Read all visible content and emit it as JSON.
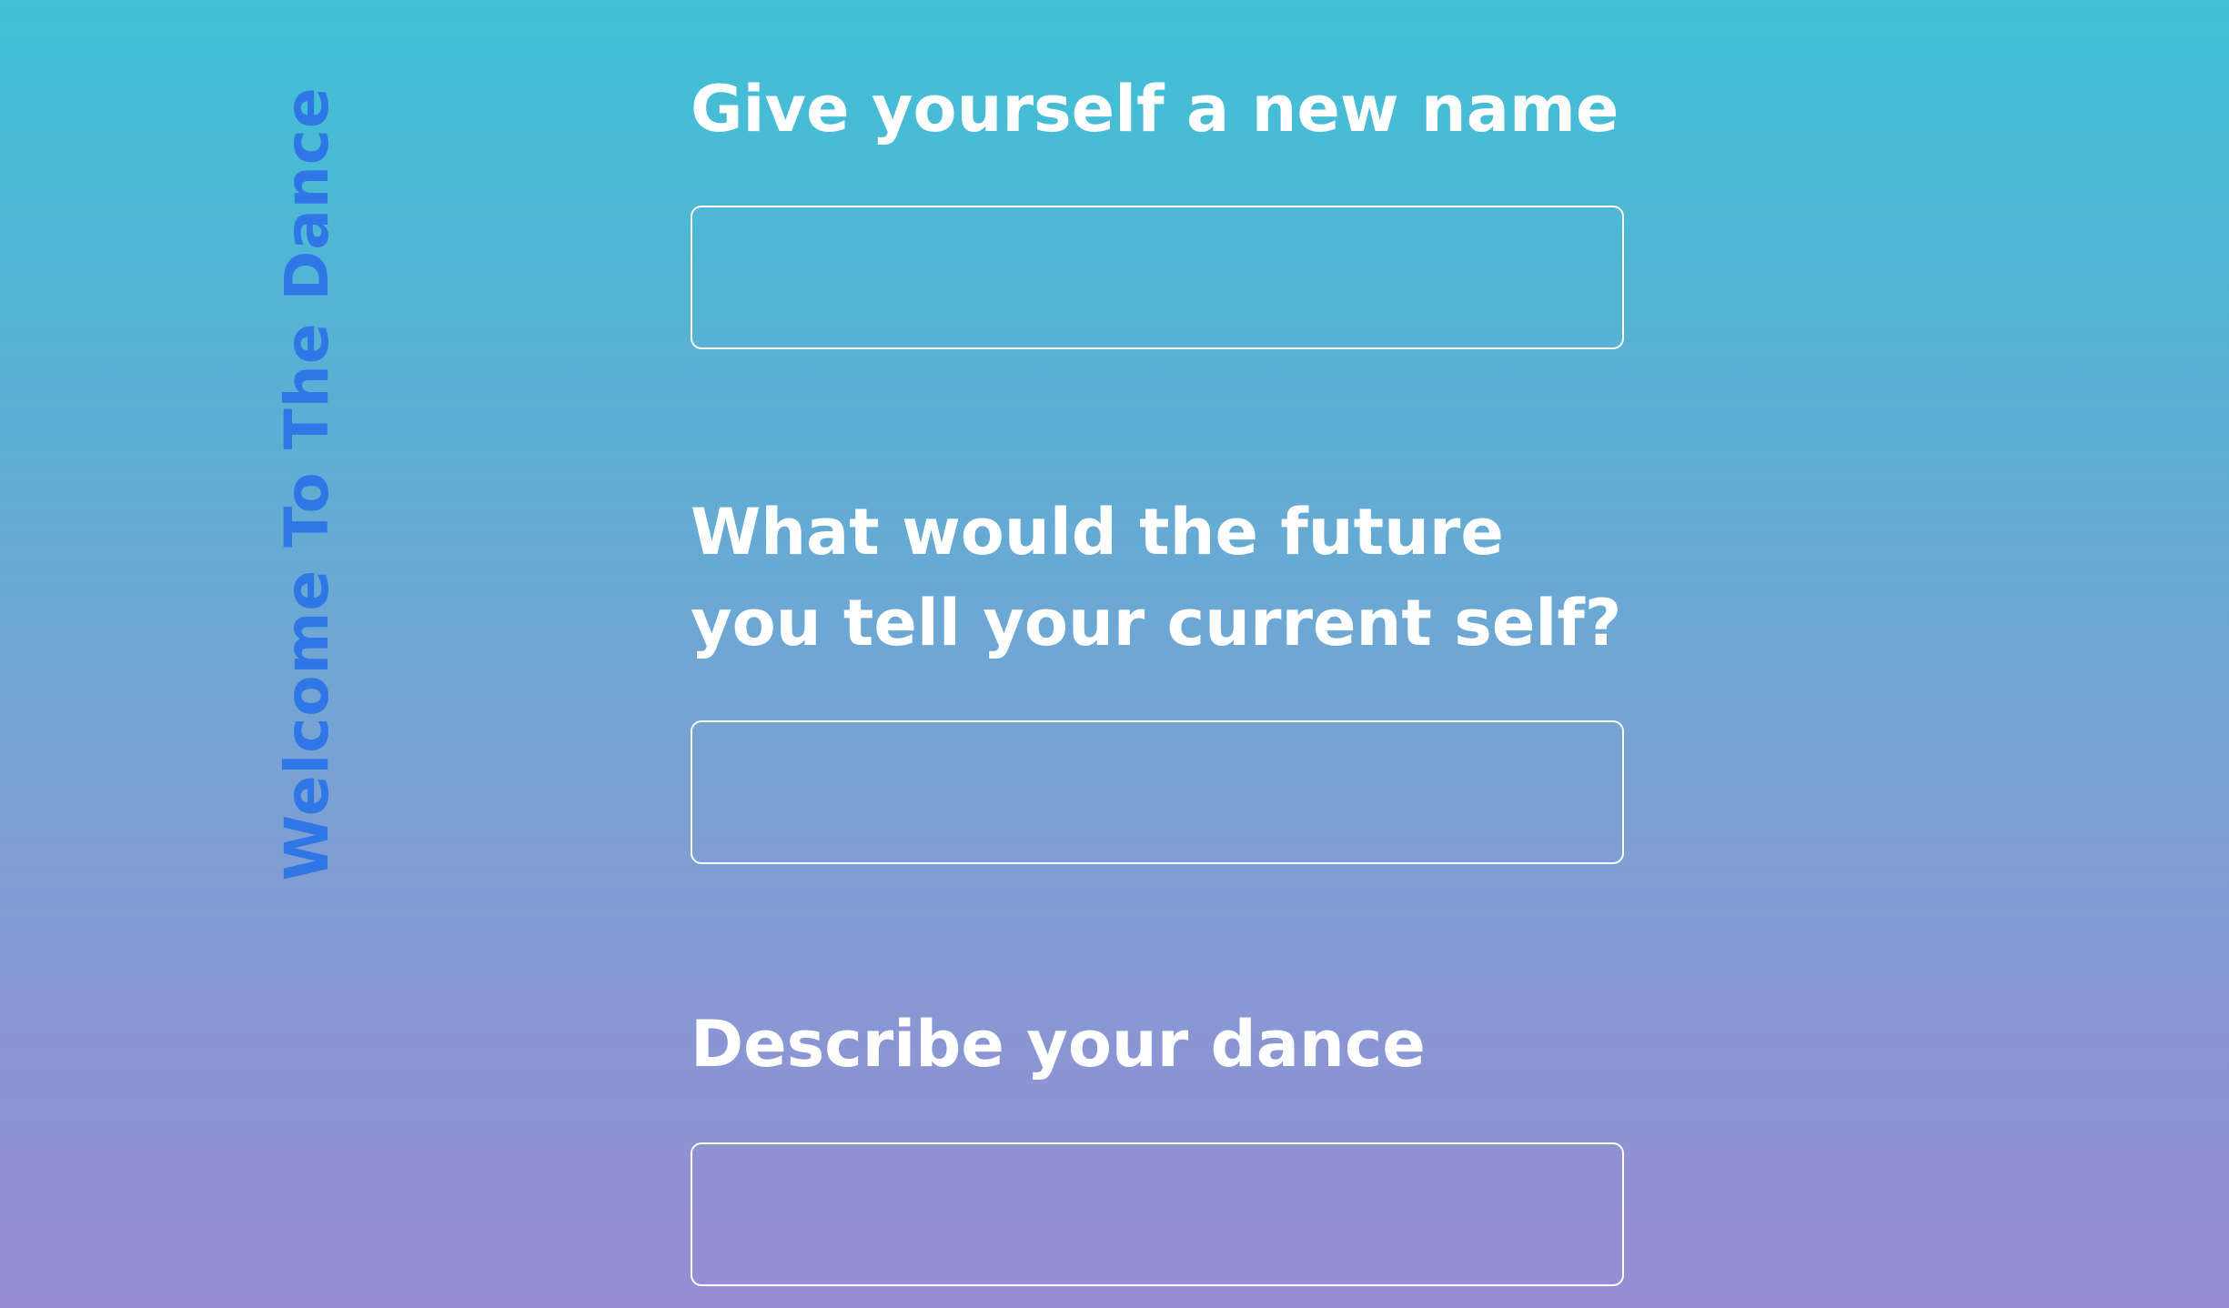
{
  "sidebar": {
    "title": "Welcome To The Dance"
  },
  "form": {
    "fields": [
      {
        "label_lines": [
          "Give yourself a new name"
        ],
        "value": "",
        "placeholder": ""
      },
      {
        "label_lines": [
          "What would the future",
          "you tell your current self?"
        ],
        "value": "",
        "placeholder": ""
      },
      {
        "label_lines": [
          "Describe your dance"
        ],
        "value": "",
        "placeholder": ""
      }
    ]
  },
  "colors": {
    "gradient_top": "#3fc1d6",
    "gradient_bottom": "#978cd4",
    "title_accent": "#2f76e6",
    "text": "#ffffff"
  }
}
